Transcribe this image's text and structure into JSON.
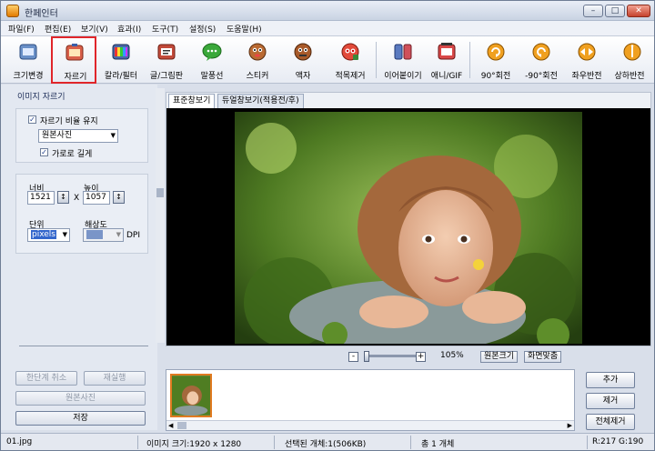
{
  "window": {
    "title": "한페인터"
  },
  "menu": [
    "파일(F)",
    "편집(E)",
    "보기(V)",
    "효과(I)",
    "도구(T)",
    "설정(S)",
    "도움말(H)"
  ],
  "toolbar": [
    {
      "label": "크기변경",
      "icon": "resize-icon"
    },
    {
      "label": "자르기",
      "icon": "crop-icon"
    },
    {
      "label": "칼라/필터",
      "icon": "color-filter-icon"
    },
    {
      "label": "글/그림판",
      "icon": "text-draw-icon"
    },
    {
      "label": "말풍선",
      "icon": "speech-bubble-icon"
    },
    {
      "label": "스티커",
      "icon": "sticker-icon"
    },
    {
      "label": "액자",
      "icon": "frame-icon"
    },
    {
      "label": "적목제거",
      "icon": "red-eye-icon"
    },
    {
      "label": "이어붙이기",
      "icon": "merge-icon"
    },
    {
      "label": "애니/GIF",
      "icon": "gif-icon"
    },
    {
      "label": "90°회전",
      "icon": "rotate-cw-icon"
    },
    {
      "label": "-90°회전",
      "icon": "rotate-ccw-icon"
    },
    {
      "label": "좌우반전",
      "icon": "flip-h-icon"
    },
    {
      "label": "상하반전",
      "icon": "flip-v-icon"
    }
  ],
  "panel": {
    "title": "이미지 자르기",
    "keep_ratio": "자르기 비율 유지",
    "ratio_select": "원본사진",
    "landscape": "가로로 길게",
    "width_label": "너비",
    "width_value": "1521",
    "x_sep": "X",
    "height_label": "높이",
    "height_value": "1057",
    "unit_label": "단위",
    "unit_value": "pixels",
    "res_label": "해상도",
    "res_value": "",
    "dpi": "DPI",
    "undo": "한단계 취소",
    "redo": "재실행",
    "original": "원본사진",
    "save": "저장"
  },
  "tabs": [
    "표준창보기",
    "듀얼창보기(적용전/후)"
  ],
  "zoom": {
    "minus": "-",
    "plus": "+",
    "value": "105%",
    "original_size": "원본크기",
    "fit": "화면맞춤"
  },
  "right_buttons": {
    "add": "추가",
    "remove": "제거",
    "remove_all": "전체제거"
  },
  "status": {
    "file": "01.jpg",
    "size": "이미지 크기:1920 x 1280",
    "selected": "선택된 개체:1(506KB)",
    "total": "총 1 개체",
    "pixel": "R:217 G:190"
  }
}
